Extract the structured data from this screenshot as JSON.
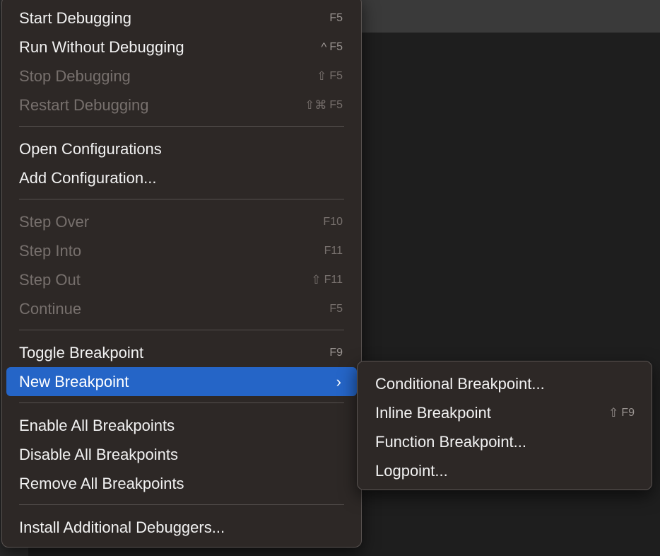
{
  "menu": {
    "groups": [
      {
        "items": [
          {
            "label": "Start Debugging",
            "shortcut": "F5",
            "enabled": true
          },
          {
            "label": "Run Without Debugging",
            "modifier": "^",
            "shortcut": "F5",
            "enabled": true
          },
          {
            "label": "Stop Debugging",
            "modifier": "⇧",
            "shortcut": "F5",
            "enabled": false
          },
          {
            "label": "Restart Debugging",
            "modifier": "⇧⌘",
            "shortcut": "F5",
            "enabled": false
          }
        ]
      },
      {
        "items": [
          {
            "label": "Open Configurations",
            "enabled": true
          },
          {
            "label": "Add Configuration...",
            "enabled": true
          }
        ]
      },
      {
        "items": [
          {
            "label": "Step Over",
            "shortcut": "F10",
            "enabled": false
          },
          {
            "label": "Step Into",
            "shortcut": "F11",
            "enabled": false
          },
          {
            "label": "Step Out",
            "modifier": "⇧",
            "shortcut": "F11",
            "enabled": false
          },
          {
            "label": "Continue",
            "shortcut": "F5",
            "enabled": false
          }
        ]
      },
      {
        "items": [
          {
            "label": "Toggle Breakpoint",
            "shortcut": "F9",
            "enabled": true
          },
          {
            "label": "New Breakpoint",
            "submenu_indicator": "›",
            "enabled": true,
            "highlighted": true
          }
        ]
      },
      {
        "items": [
          {
            "label": "Enable All Breakpoints",
            "enabled": true
          },
          {
            "label": "Disable All Breakpoints",
            "enabled": true
          },
          {
            "label": "Remove All Breakpoints",
            "enabled": true
          }
        ]
      },
      {
        "items": [
          {
            "label": "Install Additional Debuggers...",
            "enabled": true
          }
        ]
      }
    ]
  },
  "submenu": {
    "items": [
      {
        "label": "Conditional Breakpoint...",
        "enabled": true
      },
      {
        "label": "Inline Breakpoint",
        "modifier": "⇧",
        "shortcut": "F9",
        "enabled": true
      },
      {
        "label": "Function Breakpoint...",
        "enabled": true
      },
      {
        "label": "Logpoint...",
        "enabled": true
      }
    ]
  },
  "colors": {
    "menu_background": "#2d2826",
    "highlight": "#2565c7",
    "text": "#f2f2f2",
    "disabled_text": "#77706d"
  }
}
